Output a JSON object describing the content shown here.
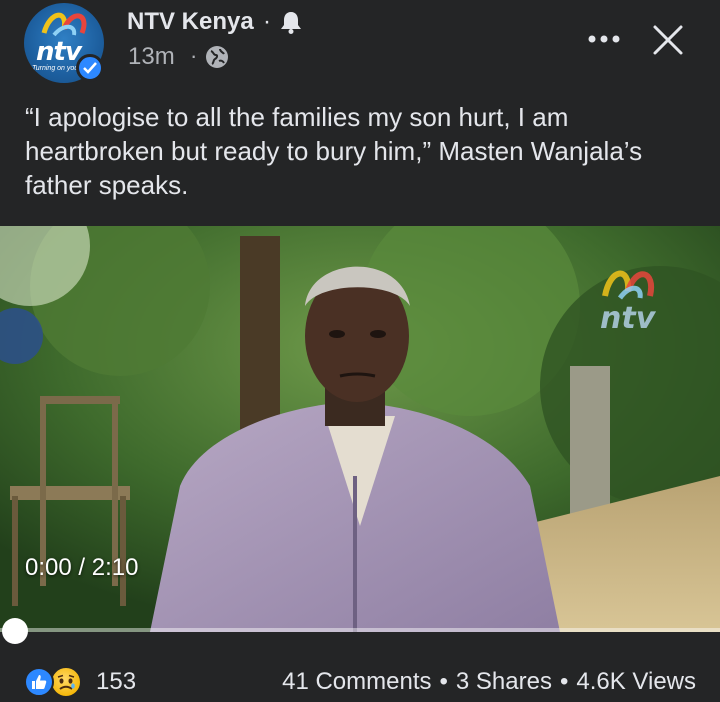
{
  "post": {
    "page_name": "NTV Kenya",
    "name_separator": "·",
    "time_ago": "13m",
    "time_separator": "·",
    "avatar_logo_text": "ntv",
    "avatar_tagline": "Turning on you",
    "verified": true,
    "audience_icon": "globe-icon",
    "notification_icon": "bell-icon",
    "caption": "“I apologise to all the families my son hurt, I am heartbroken but ready to bury him,” Masten Wanjala’s father speaks."
  },
  "header_actions": {
    "more_icon": "more-options-icon",
    "close_icon": "close-icon"
  },
  "video": {
    "current_time": "0:00",
    "duration": "2:10",
    "timecode": "0:00 / 2:10",
    "progress_fraction": 0.0,
    "watermark": "ntv"
  },
  "engagement": {
    "reaction_icons": [
      "like-icon",
      "sad-icon"
    ],
    "reaction_count": "153",
    "comments": "41 Comments",
    "shares": "3 Shares",
    "views": "4.6K Views",
    "separator": "•"
  },
  "colors": {
    "background": "#242526",
    "primary_text": "#e4e6eb",
    "secondary_text": "#b0b3b8",
    "accent_blue": "#2d88ff"
  }
}
